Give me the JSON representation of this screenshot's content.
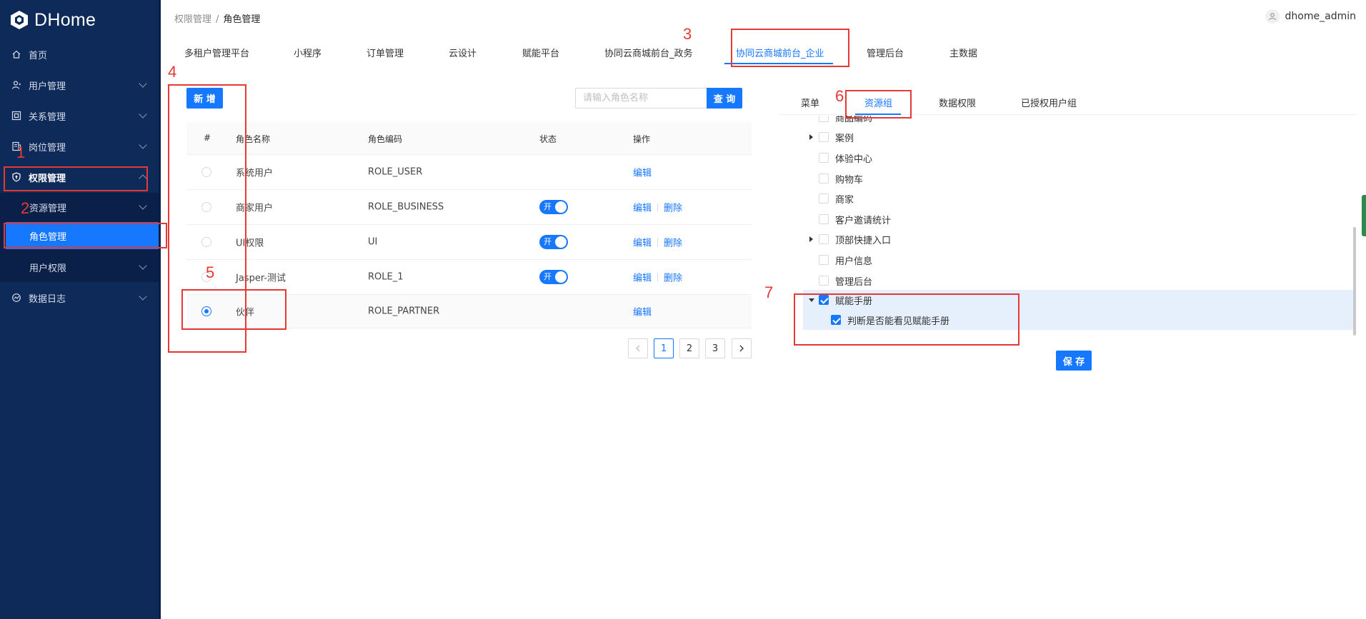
{
  "app": {
    "logo_text": "DHome"
  },
  "sidebar": {
    "items": [
      {
        "label": "首页",
        "icon": "home-icon"
      },
      {
        "label": "用户管理",
        "icon": "user-icon"
      },
      {
        "label": "关系管理",
        "icon": "relation-icon"
      },
      {
        "label": "岗位管理",
        "icon": "post-icon"
      },
      {
        "label": "权限管理",
        "icon": "shield-icon"
      },
      {
        "label": "资源管理"
      },
      {
        "label": "角色管理"
      },
      {
        "label": "用户权限"
      },
      {
        "label": "数据日志",
        "icon": "log-icon"
      }
    ]
  },
  "header": {
    "breadcrumb": [
      "权限管理",
      "角色管理"
    ],
    "breadcrumb_sep": "/",
    "username": "dhome_admin"
  },
  "top_tabs": [
    "多租户管理平台",
    "小程序",
    "订单管理",
    "云设计",
    "赋能平台",
    "协同云商城前台_政务",
    "协同云商城前台_企业",
    "管理后台",
    "主数据"
  ],
  "toolbar": {
    "add_label": "新 增",
    "search_placeholder": "请输入角色名称",
    "search_label": "查 询"
  },
  "table": {
    "headers": [
      "#",
      "角色名称",
      "角色编码",
      "状态",
      "操作"
    ],
    "rows": [
      {
        "name": "系统用户",
        "code": "ROLE_USER",
        "switch": false,
        "actions": [
          "编辑"
        ],
        "selected": false
      },
      {
        "name": "商家用户",
        "code": "ROLE_BUSINESS",
        "switch": true,
        "actions": [
          "编辑",
          "删除"
        ],
        "selected": false
      },
      {
        "name": "UI权限",
        "code": "UI",
        "switch": true,
        "actions": [
          "编辑",
          "删除"
        ],
        "selected": false
      },
      {
        "name": "Jasper-测试",
        "code": "ROLE_1",
        "switch": true,
        "actions": [
          "编辑",
          "删除"
        ],
        "selected": false
      },
      {
        "name": "伙伴",
        "code": "ROLE_PARTNER",
        "switch": false,
        "actions": [
          "编辑"
        ],
        "selected": true
      }
    ],
    "switch_on_label": "开"
  },
  "pagination": {
    "pages": [
      "1",
      "2",
      "3"
    ],
    "current": "1"
  },
  "right_tabs": [
    "菜单",
    "资源组",
    "数据权限",
    "已授权用户组"
  ],
  "tree": {
    "nodes": [
      {
        "label": "商品编码",
        "expandable": false,
        "checked": false,
        "level": 0
      },
      {
        "label": "案例",
        "expandable": true,
        "checked": false,
        "level": 0
      },
      {
        "label": "体验中心",
        "expandable": false,
        "checked": false,
        "level": 0
      },
      {
        "label": "购物车",
        "expandable": false,
        "checked": false,
        "level": 0
      },
      {
        "label": "商家",
        "expandable": false,
        "checked": false,
        "level": 0
      },
      {
        "label": "客户邀请统计",
        "expandable": false,
        "checked": false,
        "level": 0
      },
      {
        "label": "顶部快捷入口",
        "expandable": true,
        "checked": false,
        "level": 0
      },
      {
        "label": "用户信息",
        "expandable": false,
        "checked": false,
        "level": 0
      },
      {
        "label": "管理后台",
        "expandable": false,
        "checked": false,
        "level": 0
      },
      {
        "label": "赋能手册",
        "expandable": true,
        "expanded": true,
        "checked": true,
        "level": 0
      },
      {
        "label": "判断是否能看见赋能手册",
        "expandable": false,
        "checked": true,
        "level": 1
      }
    ]
  },
  "save_label": "保 存",
  "annotations": [
    "1",
    "2",
    "3",
    "4",
    "5",
    "6",
    "7"
  ],
  "colors": {
    "primary": "#1677ff",
    "sidebar": "#0e2a58",
    "annotation": "#e53935"
  }
}
